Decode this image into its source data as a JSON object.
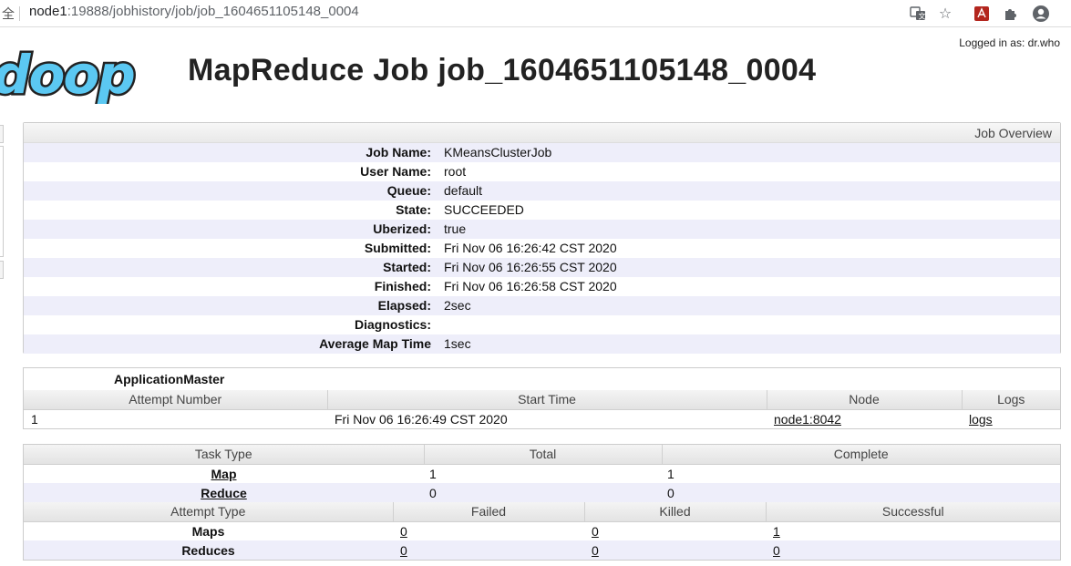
{
  "browser": {
    "secure_label": "全",
    "url_host": "node1",
    "url_path": ":19888/jobhistory/job/job_1604651105148_0004",
    "icons": [
      "translate-icon",
      "star-icon",
      "pdf-icon",
      "extensions-icon",
      "account-icon"
    ]
  },
  "header": {
    "logged_in": "Logged in as: dr.who",
    "logo_text": "doop",
    "title": "MapReduce Job job_1604651105148_0004"
  },
  "overview": {
    "heading": "Job Overview",
    "rows": [
      {
        "label": "Job Name:",
        "value": "KMeansClusterJob"
      },
      {
        "label": "User Name:",
        "value": "root"
      },
      {
        "label": "Queue:",
        "value": "default"
      },
      {
        "label": "State:",
        "value": "SUCCEEDED"
      },
      {
        "label": "Uberized:",
        "value": "true"
      },
      {
        "label": "Submitted:",
        "value": "Fri Nov 06 16:26:42 CST 2020"
      },
      {
        "label": "Started:",
        "value": "Fri Nov 06 16:26:55 CST 2020"
      },
      {
        "label": "Finished:",
        "value": "Fri Nov 06 16:26:58 CST 2020"
      },
      {
        "label": "Elapsed:",
        "value": "2sec"
      },
      {
        "label": "Diagnostics:",
        "value": ""
      },
      {
        "label": "Average Map Time",
        "value": "1sec"
      }
    ]
  },
  "app_master": {
    "title": "ApplicationMaster",
    "columns": [
      "Attempt Number",
      "Start Time",
      "Node",
      "Logs"
    ],
    "row": {
      "attempt": "1",
      "start_time": "Fri Nov 06 16:26:49 CST 2020",
      "node": "node1:8042",
      "logs": "logs"
    }
  },
  "tasks": {
    "task_columns": [
      "Task Type",
      "Total",
      "Complete"
    ],
    "task_rows": [
      {
        "type": "Map",
        "total": "1",
        "complete": "1"
      },
      {
        "type": "Reduce",
        "total": "0",
        "complete": "0"
      }
    ],
    "attempt_columns": [
      "Attempt Type",
      "Failed",
      "Killed",
      "Successful"
    ],
    "attempt_rows": [
      {
        "type": "Maps",
        "failed": "0",
        "killed": "0",
        "successful": "1"
      },
      {
        "type": "Reduces",
        "failed": "0",
        "killed": "0",
        "successful": "0"
      }
    ]
  },
  "colors": {
    "stripe": "#eeeefa",
    "logo_blue": "#5bc8f2"
  }
}
